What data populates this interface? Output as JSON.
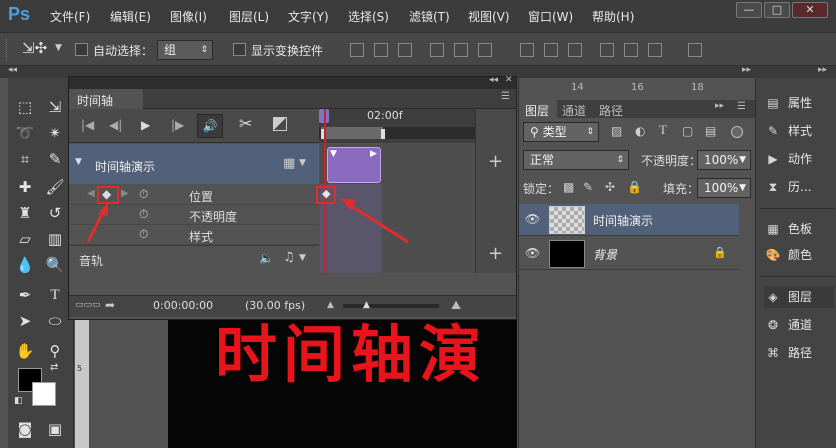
{
  "app": {
    "logo": "Ps"
  },
  "menu": [
    "文件(F)",
    "编辑(E)",
    "图像(I)",
    "图层(L)",
    "文字(Y)",
    "选择(S)",
    "滤镜(T)",
    "视图(V)",
    "窗口(W)",
    "帮助(H)"
  ],
  "window_controls": {
    "minimize": "—",
    "restore": "□",
    "close": "✕"
  },
  "options": {
    "auto_select_label": "自动选择：",
    "auto_select_value": "组",
    "show_transform_label": "显示变换控件"
  },
  "document": {
    "canvas_text": "时间轴演"
  },
  "timeline": {
    "panel_title": "时间轴",
    "ruler_label": "02:00f",
    "layer_name": "时间轴演示",
    "properties": [
      "位置",
      "不透明度",
      "样式"
    ],
    "audio_track": "音轨",
    "timecode": "0:00:00:00",
    "fps": "(30.00 fps)",
    "ruler_marks": [
      "14",
      "16",
      "18"
    ]
  },
  "layers_panel": {
    "tabs": [
      "图层",
      "通道",
      "路径"
    ],
    "filter_label": "类型",
    "blend_mode": "正常",
    "opacity_label": "不透明度：",
    "opacity_value": "100%",
    "lock_label": "锁定：",
    "fill_label": "填充：",
    "fill_value": "100%",
    "layers": [
      {
        "name": "时间轴演示"
      },
      {
        "name": "背景"
      }
    ]
  },
  "dock": {
    "group1": [
      {
        "label": "属性",
        "icon": "properties-icon"
      },
      {
        "label": "样式",
        "icon": "styles-icon"
      },
      {
        "label": "动作",
        "icon": "actions-icon"
      },
      {
        "label": "历...",
        "icon": "history-icon"
      }
    ],
    "group2": [
      {
        "label": "色板",
        "icon": "swatches-icon"
      },
      {
        "label": "颜色",
        "icon": "color-icon"
      }
    ],
    "group3": [
      {
        "label": "图层",
        "icon": "layers-icon"
      },
      {
        "label": "通道",
        "icon": "channels-icon"
      },
      {
        "label": "路径",
        "icon": "paths-icon"
      }
    ]
  },
  "colors": {
    "accent_red": "#e32d2d",
    "clip_purple": "#8a6bbf",
    "canvas_text": "#e8141c",
    "selected_layer": "#52617a"
  }
}
